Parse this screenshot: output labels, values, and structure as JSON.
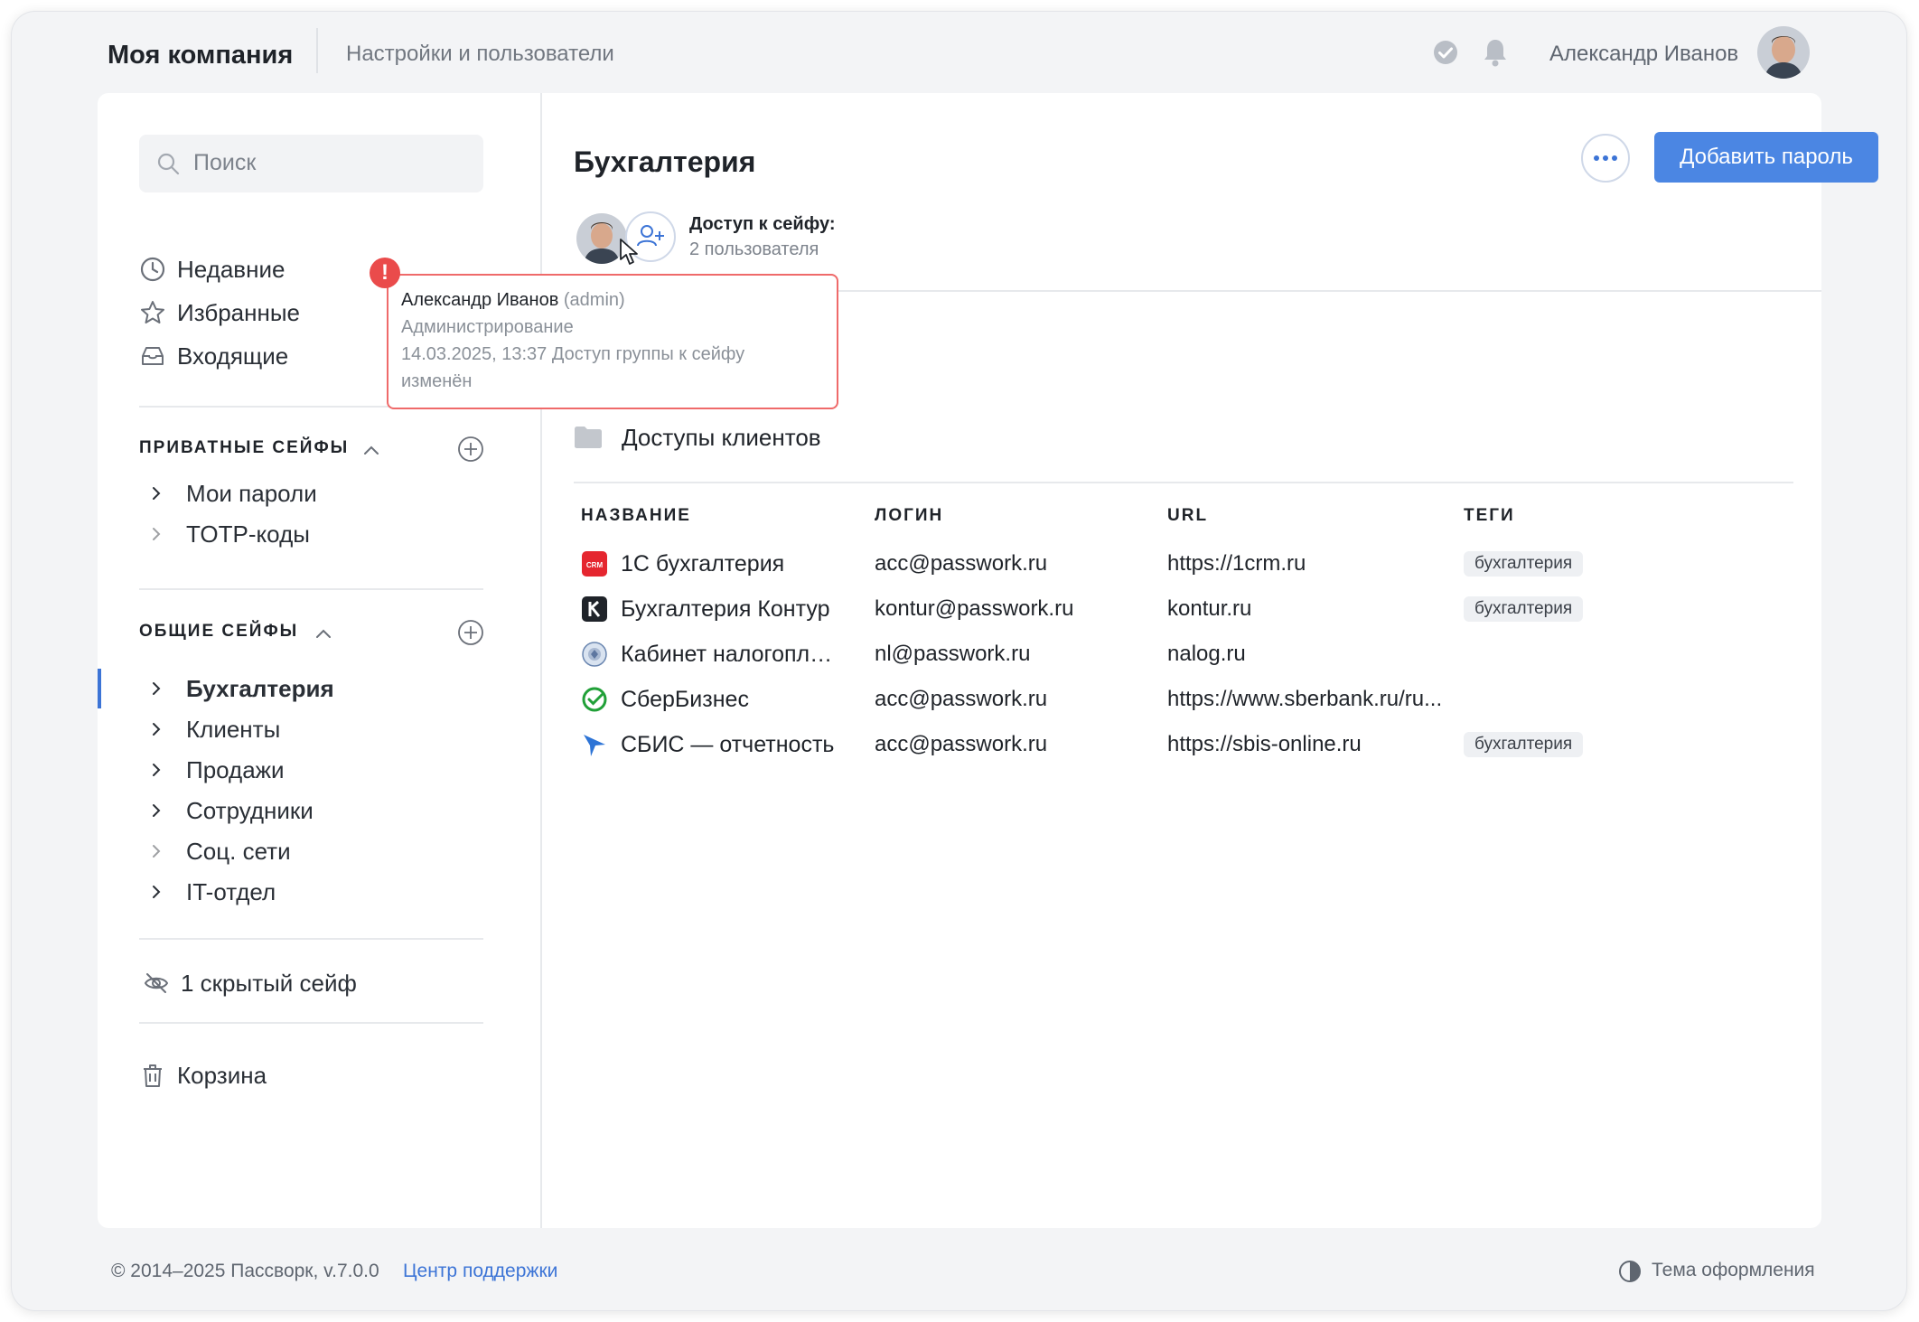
{
  "header": {
    "company": "Моя компания",
    "page": "Настройки и пользователи",
    "user_name": "Александр Иванов"
  },
  "sidebar": {
    "search_placeholder": "Поиск",
    "quick": [
      {
        "label": "Недавние",
        "icon": "clock-icon"
      },
      {
        "label": "Избранные",
        "icon": "star-icon"
      },
      {
        "label": "Входящие",
        "icon": "inbox-icon"
      }
    ],
    "private_title": "ПРИВАТНЫЕ СЕЙФЫ",
    "private_vaults": [
      {
        "label": "Мои пароли"
      },
      {
        "label": "TOTP-коды"
      }
    ],
    "shared_title": "ОБЩИЕ СЕЙФЫ",
    "shared_vaults": [
      {
        "label": "Бухгалтерия",
        "active": true
      },
      {
        "label": "Клиенты"
      },
      {
        "label": "Продажи"
      },
      {
        "label": "Сотрудники"
      },
      {
        "label": "Соц. сети"
      },
      {
        "label": "IT-отдел"
      }
    ],
    "hidden": "1 скрытый сейф",
    "trash": "Корзина"
  },
  "main": {
    "title": "Бухгалтерия",
    "add_button": "Добавить пароль",
    "access_title": "Доступ к сейфу:",
    "access_count": "2 пользователя",
    "folder": "Доступы клиентов",
    "columns": [
      "НАЗВАНИЕ",
      "ЛОГИН",
      "URL",
      "ТЕГИ"
    ],
    "rows": [
      {
        "name": "1С бухгалтерия",
        "icon": "crm-icon",
        "login": "acc@passwork.ru",
        "url": "https://1crm.ru",
        "tag": "бухгалтерия"
      },
      {
        "name": "Бухгалтерия Контур",
        "icon": "kontur-icon",
        "login": "kontur@passwork.ru",
        "url": "kontur.ru",
        "tag": "бухгалтерия"
      },
      {
        "name": "Кабинет налогоплат...",
        "icon": "nalog-icon",
        "login": "nl@passwork.ru",
        "url": "nalog.ru",
        "tag": ""
      },
      {
        "name": "СберБизнес",
        "icon": "sber-icon",
        "login": "acc@passwork.ru",
        "url": "https://www.sberbank.ru/ru...",
        "tag": ""
      },
      {
        "name": "СБИС — отчетность",
        "icon": "sbis-icon",
        "login": "acc@passwork.ru",
        "url": "https://sbis-online.ru",
        "tag": "бухгалтерия"
      }
    ]
  },
  "tooltip": {
    "name": "Александр Иванов",
    "role": "(admin)",
    "line2": "Администрирование",
    "line3": "14.03.2025, 13:37 Доступ группы к сейфу",
    "line4": "изменён",
    "badge": "!"
  },
  "footer": {
    "copyright": "© 2014–2025 Пассворк, v.7.0.0",
    "support": "Центр поддержки",
    "theme": "Тема оформления"
  },
  "colors": {
    "accent": "#4b86e3",
    "alert": "#ea4b4b",
    "link": "#3c74d6"
  }
}
